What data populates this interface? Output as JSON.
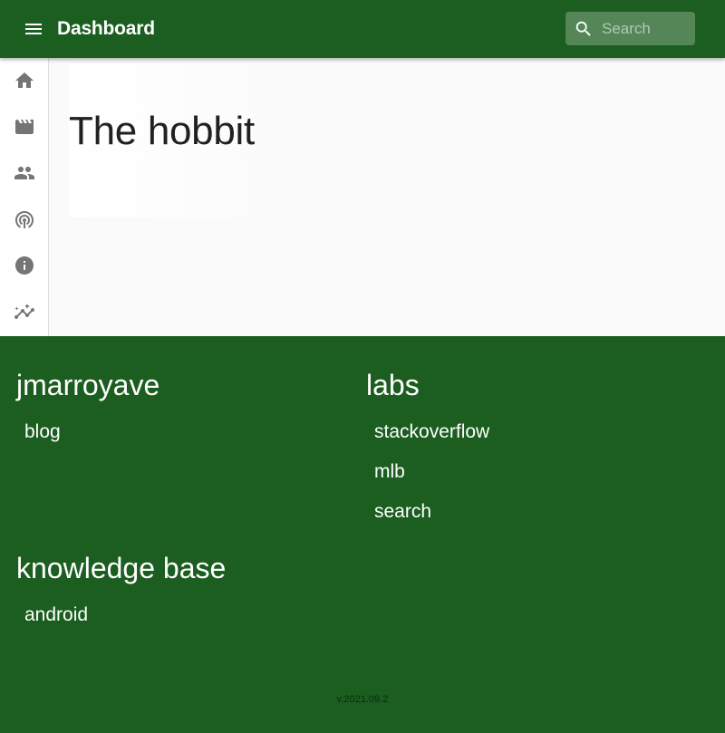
{
  "app_bar": {
    "title": "Dashboard",
    "menu_icon": "menu-icon",
    "search": {
      "placeholder": "Search",
      "value": "",
      "icon": "search-icon"
    },
    "color": "#1b5e20"
  },
  "sidebar": {
    "items": [
      {
        "icon": "home-icon"
      },
      {
        "icon": "movie-icon"
      },
      {
        "icon": "people-icon"
      },
      {
        "icon": "podcast-icon"
      },
      {
        "icon": "info-icon"
      },
      {
        "icon": "insights-icon"
      }
    ]
  },
  "main": {
    "title": "The hobbit"
  },
  "footer": {
    "sections": [
      {
        "heading": "jmarroyave",
        "links": [
          "blog"
        ]
      },
      {
        "heading": "labs",
        "links": [
          "stackoverflow",
          "mlb",
          "search"
        ]
      },
      {
        "heading": "knowledge base",
        "links": [
          "android"
        ]
      }
    ],
    "version": "v.2021.09.2"
  }
}
